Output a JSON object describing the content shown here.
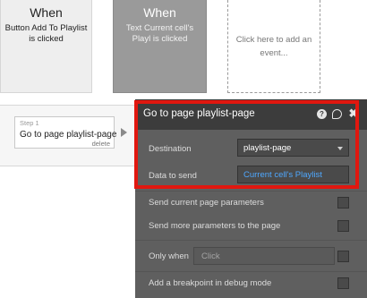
{
  "events": [
    {
      "when": "When",
      "desc_line1": "Button Add To Playlist",
      "desc_line2": "is clicked"
    },
    {
      "when": "When",
      "desc_line1": "Text Current cell's",
      "desc_line2": "Playl is clicked"
    },
    {
      "placeholder_line1": "Click here to add an",
      "placeholder_line2": "event..."
    }
  ],
  "step": {
    "number": "Step 1",
    "title": "Go to page playlist-page",
    "delete_label": "delete"
  },
  "panel": {
    "title": "Go to page playlist-page",
    "icons": {
      "help": "help-icon",
      "comment": "comment-icon",
      "close": "close-icon"
    },
    "destination_label": "Destination",
    "destination_value": "playlist-page",
    "data_to_send_label": "Data to send",
    "data_to_send_value": "Current cell's Playlist",
    "send_current_params_label": "Send current page parameters",
    "send_more_params_label": "Send more parameters to the page",
    "only_when_label": "Only when",
    "only_when_placeholder": "Click",
    "breakpoint_label": "Add a breakpoint in debug mode"
  },
  "colors": {
    "highlight": "#e1170f",
    "link": "#4fa8ff",
    "panel_bg": "#5f5f5f",
    "header_bg": "#3c3c3c"
  }
}
